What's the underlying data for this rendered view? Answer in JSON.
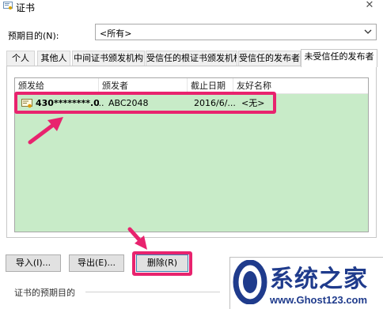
{
  "window": {
    "title": "证书"
  },
  "purpose": {
    "label": "预期目的(N):",
    "selected": "<所有>"
  },
  "tabs": [
    {
      "label": "个人"
    },
    {
      "label": "其他人"
    },
    {
      "label": "中间证书颁发机构"
    },
    {
      "label": "受信任的根证书颁发机构"
    },
    {
      "label": "受信任的发布者"
    },
    {
      "label": "未受信任的发布者"
    }
  ],
  "active_tab": "未受信任的发布者",
  "list": {
    "columns": [
      "颁发给",
      "颁发者",
      "截止日期",
      "友好名称"
    ],
    "rows": [
      {
        "issued_to": "430********.00",
        "ellipsis": "...",
        "issuer": "ABC2048",
        "expiry": "2016/6/...",
        "friendly_name": "<无>"
      }
    ],
    "background": "#c8ebc8"
  },
  "buttons": {
    "import": "导入(I)...",
    "export": "导出(E)...",
    "remove": "删除(R)"
  },
  "section": {
    "label": "证书的预期目的"
  },
  "highlight_color": "#e8236e",
  "watermark": {
    "title": "系统之家",
    "url": "www.Ghost123.com"
  }
}
